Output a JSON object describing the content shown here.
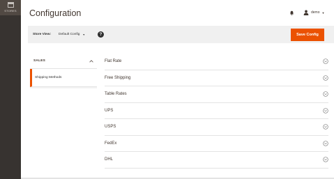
{
  "sidebar": {
    "stores_label": "STORES"
  },
  "header": {
    "title": "Configuration",
    "user_name": "demo"
  },
  "scope": {
    "label": "Store View:",
    "value": "Default Config",
    "help": "?",
    "save_label": "Save Config"
  },
  "tabs": {
    "group_label": "SALES",
    "active_item": "Shipping Methods"
  },
  "sections": [
    {
      "title": "Flat Rate"
    },
    {
      "title": "Free Shipping"
    },
    {
      "title": "Table Rates"
    },
    {
      "title": "UPS"
    },
    {
      "title": "USPS"
    },
    {
      "title": "FedEx"
    },
    {
      "title": "DHL"
    }
  ],
  "colors": {
    "accent": "#eb5202",
    "rail": "#373330",
    "text": "#41362f"
  }
}
